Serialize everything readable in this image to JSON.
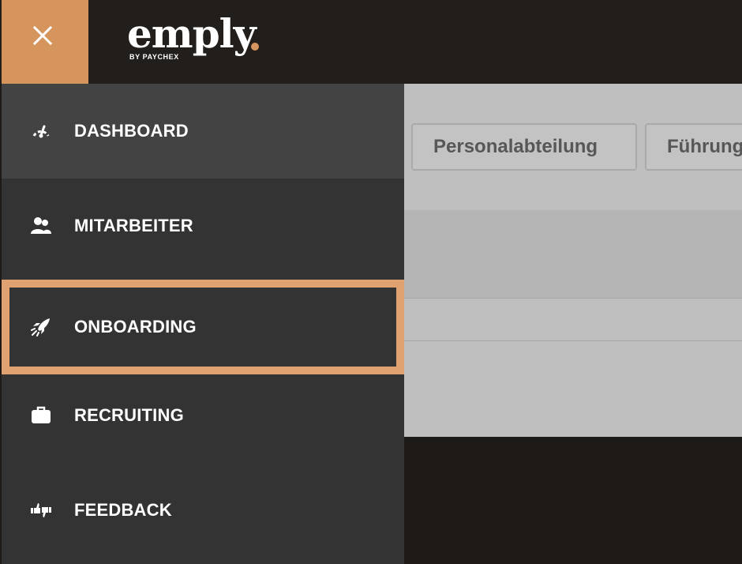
{
  "app": {
    "logo_text": "emply",
    "logo_sub": "BY PAYCHEX",
    "brand_color": "#d7955e"
  },
  "header": {
    "close_icon": "close-icon"
  },
  "sidebar": {
    "items": [
      {
        "label": "DASHBOARD",
        "icon": "dashboard-gauge-icon",
        "state": "active"
      },
      {
        "label": "MITARBEITER",
        "icon": "users-icon",
        "state": "normal"
      },
      {
        "label": "ONBOARDING",
        "icon": "rocket-icon",
        "state": "selected"
      },
      {
        "label": "RECRUITING",
        "icon": "briefcase-icon",
        "state": "normal"
      },
      {
        "label": "FEEDBACK",
        "icon": "thumbs-feedback-icon",
        "state": "normal"
      }
    ]
  },
  "content": {
    "tabs": [
      {
        "label": "Personalabteilung"
      },
      {
        "label": "Führung"
      }
    ]
  }
}
